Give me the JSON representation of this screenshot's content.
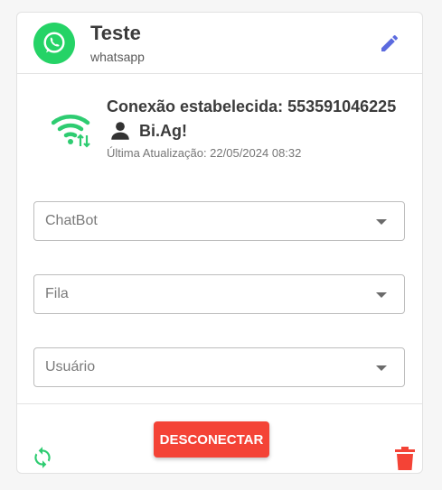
{
  "header": {
    "title": "Teste",
    "subtitle": "whatsapp",
    "avatar_icon": "whatsapp-icon",
    "edit_icon": "edit-pencil-icon"
  },
  "status": {
    "connection_text": "Conexão estabelecida: 553591046225",
    "user_name": "Bi.Ag!",
    "last_update": "Última Atualização: 22/05/2024 08:32",
    "wifi_icon": "wifi-sync-icon",
    "user_icon": "person-icon"
  },
  "selects": {
    "chatbot": {
      "placeholder": "ChatBot"
    },
    "queue": {
      "placeholder": "Fila"
    },
    "user": {
      "placeholder": "Usuário"
    }
  },
  "footer": {
    "disconnect_label": "DESCONECTAR",
    "refresh_icon": "refresh-icon",
    "delete_icon": "trash-icon"
  },
  "colors": {
    "whatsapp_green": "#25d366",
    "edit_blue": "#5c6bdf",
    "wifi_green": "#2ecc71",
    "danger_red": "#f44336"
  }
}
